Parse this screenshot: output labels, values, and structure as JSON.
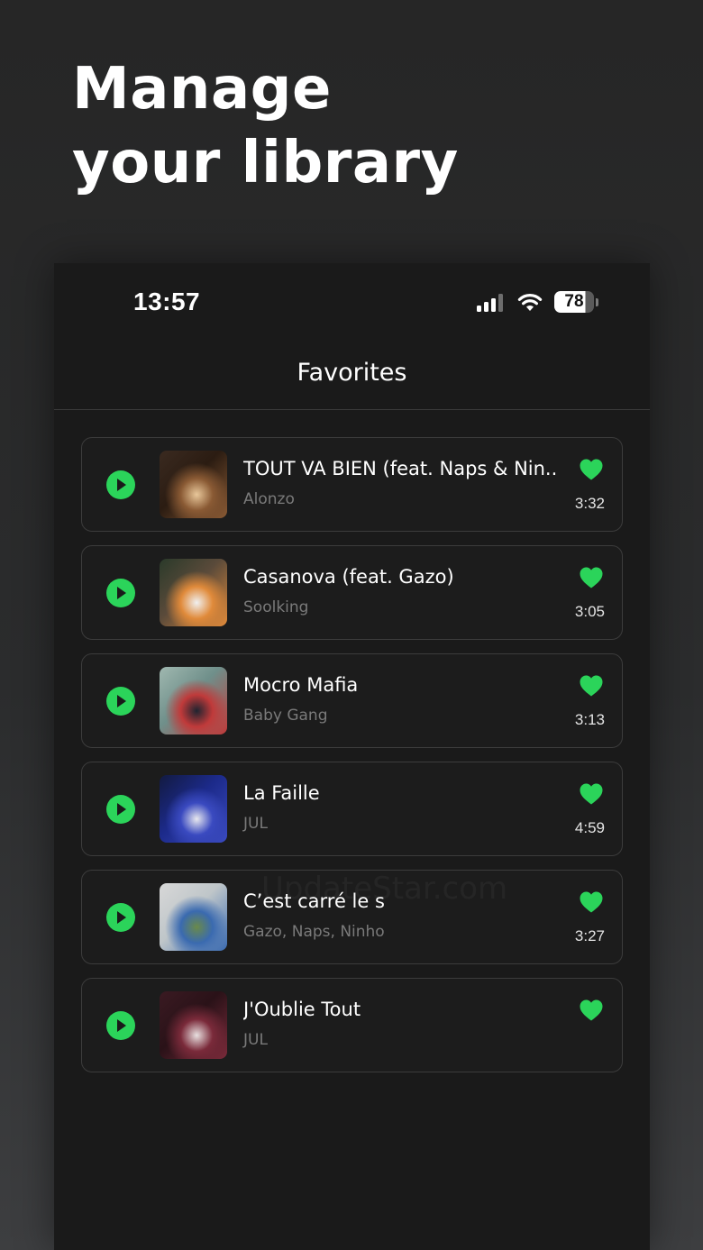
{
  "promo": {
    "heading_line1": "Manage",
    "heading_line2": "your library"
  },
  "status_bar": {
    "time": "13:57",
    "battery_level": "78",
    "signal_bars": 3,
    "icons": [
      "signal-icon",
      "wifi-icon",
      "battery-icon"
    ]
  },
  "screen": {
    "title": "Favorites"
  },
  "colors": {
    "accent_green": "#2bd45a",
    "background": "#1a1a1a",
    "card_border": "#3c3c3c",
    "secondary_text": "#7a7a7a"
  },
  "songs": [
    {
      "title": "TOUT VA BIEN (feat. Naps & Nin...",
      "artist": "Alonzo",
      "duration": "3:32",
      "favorited": true,
      "art_colors": [
        "#2b1c12",
        "#8a5a34",
        "#e8c79a",
        "#3a2a20"
      ]
    },
    {
      "title": "Casanova (feat. Gazo)",
      "artist": "Soolking",
      "duration": "3:05",
      "favorited": true,
      "art_colors": [
        "#5a4a3a",
        "#e08a3a",
        "#f0f0f0",
        "#2a3a2a"
      ]
    },
    {
      "title": "Mocro Mafia",
      "artist": "Baby Gang",
      "duration": "3:13",
      "favorited": true,
      "art_colors": [
        "#6f8f8a",
        "#c03a3a",
        "#1f2430",
        "#a0b8b0"
      ]
    },
    {
      "title": "La Faille",
      "artist": "JUL",
      "duration": "4:59",
      "favorited": true,
      "art_colors": [
        "#1c2a8a",
        "#3a4ac0",
        "#e8e8ee",
        "#121a40"
      ]
    },
    {
      "title": "C’est carré le s",
      "artist": "Gazo, Naps, Ninho",
      "duration": "3:27",
      "favorited": true,
      "art_colors": [
        "#bfc6c9",
        "#3a6ab0",
        "#6a8a4a",
        "#d8d8d8"
      ]
    },
    {
      "title": "J'Oublie Tout",
      "artist": "JUL",
      "duration": "",
      "favorited": true,
      "art_colors": [
        "#2a1218",
        "#7a2a3a",
        "#e8e0e0",
        "#3a1a22"
      ]
    }
  ]
}
